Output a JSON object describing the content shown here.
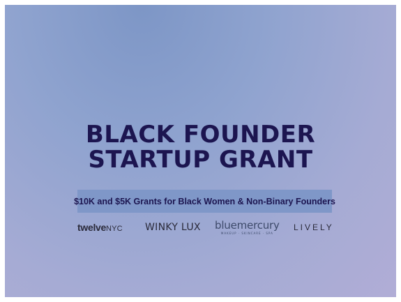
{
  "title_line1": "BLACK FOUNDER",
  "title_line2": "STARTUP GRANT",
  "subtitle": "$10K and $5K Grants for Black Women & Non-Binary Founders",
  "logos": {
    "twelve_main": "twelve",
    "twelve_suffix": "NYC",
    "winky": "WINKY LUX",
    "bluemercury": "bluemercury",
    "bluemercury_tag": "MAKEUP · SKINCARE · SPA",
    "lively": "LIVELY"
  },
  "colors": {
    "title": "#1c1550",
    "subtitle_box": "#7f97c8"
  }
}
